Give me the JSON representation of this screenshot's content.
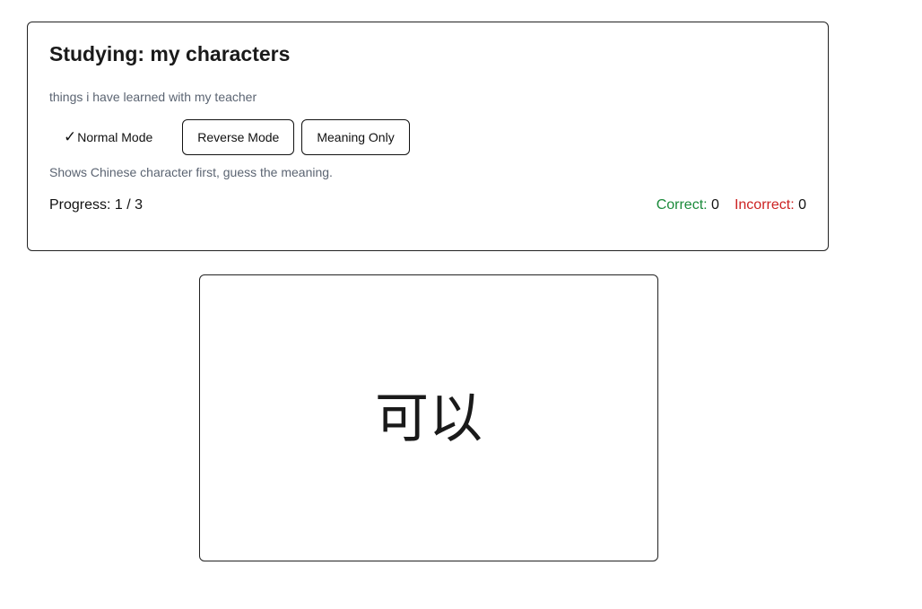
{
  "header": {
    "title": "Studying: my characters",
    "description": "things i have learned with my teacher"
  },
  "modes": [
    {
      "label": "Normal Mode",
      "active": true,
      "check": "✓"
    },
    {
      "label": "Reverse Mode",
      "active": false
    },
    {
      "label": "Meaning Only",
      "active": false
    }
  ],
  "mode_hint": "Shows Chinese character first, guess the meaning.",
  "progress": {
    "text": "Progress: 1 / 3",
    "current": 1,
    "total": 3
  },
  "stats": {
    "correct_label": "Correct:",
    "correct_value": "0",
    "incorrect_label": "Incorrect:",
    "incorrect_value": "0"
  },
  "card": {
    "text": "可以"
  },
  "colors": {
    "correct": "#1a8a3a",
    "incorrect": "#cc2222",
    "muted_text": "#5b6472",
    "border": "#222222"
  }
}
